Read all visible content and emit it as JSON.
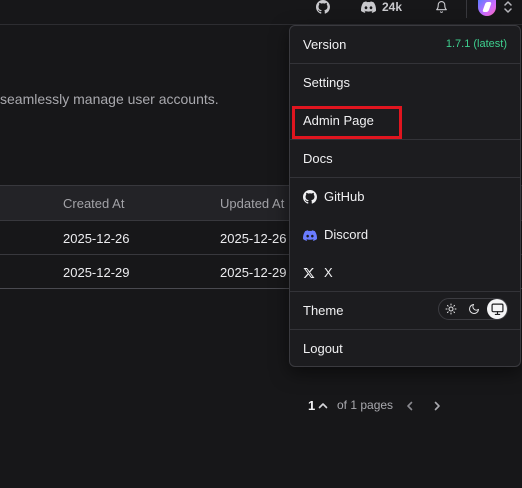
{
  "topbar": {
    "github_icon": "github-icon",
    "discord_icon": "discord-icon",
    "stars": "24k",
    "bell_icon": "bell-icon",
    "chevron_icon": "chevron-updown-icon"
  },
  "main": {
    "description": "seamlessly manage user accounts."
  },
  "table": {
    "headers": [
      "Created At",
      "Updated At"
    ],
    "rows": [
      [
        "2025-12-26",
        "2025-12-26"
      ],
      [
        "2025-12-29",
        "2025-12-29"
      ]
    ]
  },
  "pagination": {
    "current_page": "1",
    "of_text": "of 1 pages"
  },
  "menu": {
    "version_label": "Version",
    "version_value": "1.7.1 (latest)",
    "items": {
      "settings": "Settings",
      "admin": "Admin Page",
      "docs": "Docs",
      "github": "GitHub",
      "discord": "Discord",
      "x": "X",
      "theme": "Theme",
      "logout": "Logout"
    },
    "theme_options": [
      "light",
      "dark",
      "system"
    ],
    "theme_selected": "system"
  },
  "colors": {
    "background": "#171719",
    "menu_bg": "#1c1c1f",
    "version_green": "#3ecf8e",
    "highlight_red": "#e0151f"
  }
}
